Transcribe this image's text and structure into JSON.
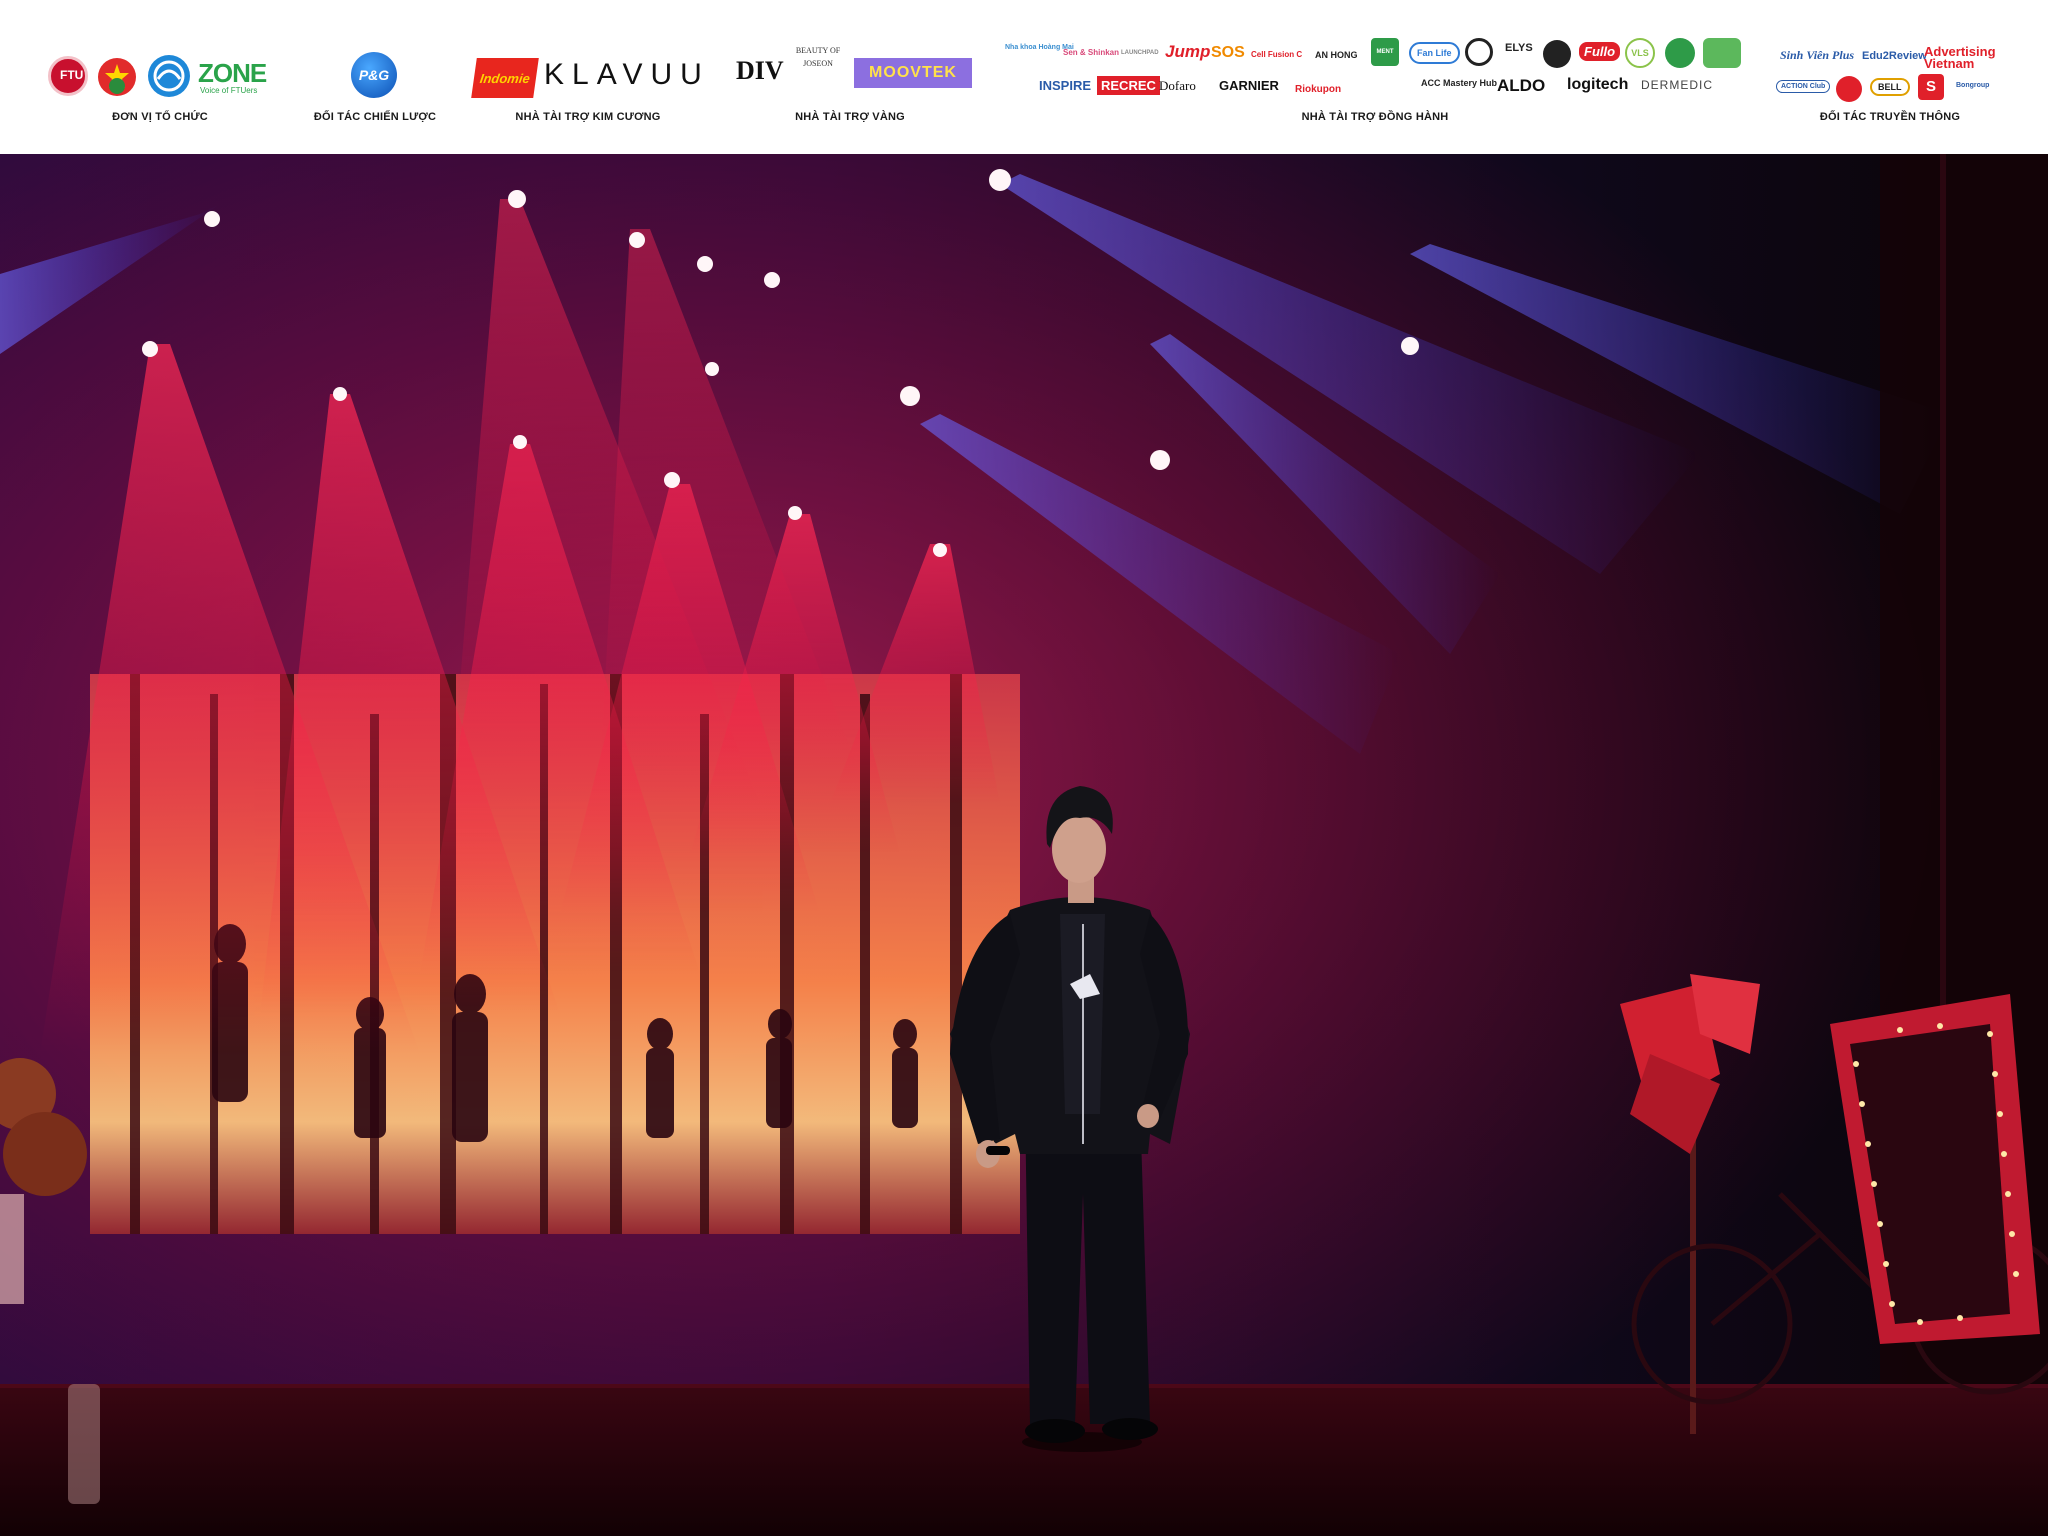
{
  "header": {
    "groups": [
      {
        "caption": "ĐƠN VỊ TỔ CHỨC",
        "logos": [
          "FTU",
          "Đoàn TN",
          "Hội SV",
          "FTU Zone"
        ],
        "zone_text": "ZONE",
        "zone_tagline": "Voice of FTUers"
      },
      {
        "caption": "ĐỐI TÁC CHIẾN LƯỢC",
        "logos": [
          "P&G"
        ]
      },
      {
        "caption": "NHÀ TÀI TRỢ KIM CƯƠNG",
        "logos": [
          "Indomie",
          "KLAVUU"
        ]
      },
      {
        "caption": "NHÀ TÀI TRỢ VÀNG",
        "logos": [
          "DIV",
          "BEAUTY OF JOSEON",
          "MOOVTEK"
        ]
      },
      {
        "caption": "NHÀ TÀI TRỢ ĐỒNG HÀNH",
        "logos_row1": [
          "Nha khoa Hoàng Mai",
          "Sen & Shinkan",
          "LAUNCHPAD",
          "Jump",
          "SOS",
          "Cell Fusion C",
          "AN HONG",
          "MENT",
          "Fan Life",
          "ELYS",
          "Fullo",
          "VLS"
        ],
        "logos_row2": [
          "INSPIRE",
          "RECREC",
          "Dofaro",
          "GARNIER",
          "Riokupon",
          "ACC Mastery Hub",
          "ALDO",
          "logitech",
          "DERMEDIC"
        ]
      },
      {
        "caption": "ĐỐI TÁC TRUYỀN THÔNG",
        "logos_row1": [
          "Sinh Viên Plus",
          "Edu2Review",
          "Advertising Vietnam"
        ],
        "logos_row2": [
          "ACTION Club",
          "BELL",
          "S",
          "Bongroup"
        ]
      }
    ]
  },
  "photo": {
    "subject": "performer-on-stage",
    "colors": {
      "red_light": "#e8123a",
      "blue_light": "#3a3cff",
      "backdrop_fire": "#ffb060",
      "stage_dark": "#1a0208"
    }
  }
}
